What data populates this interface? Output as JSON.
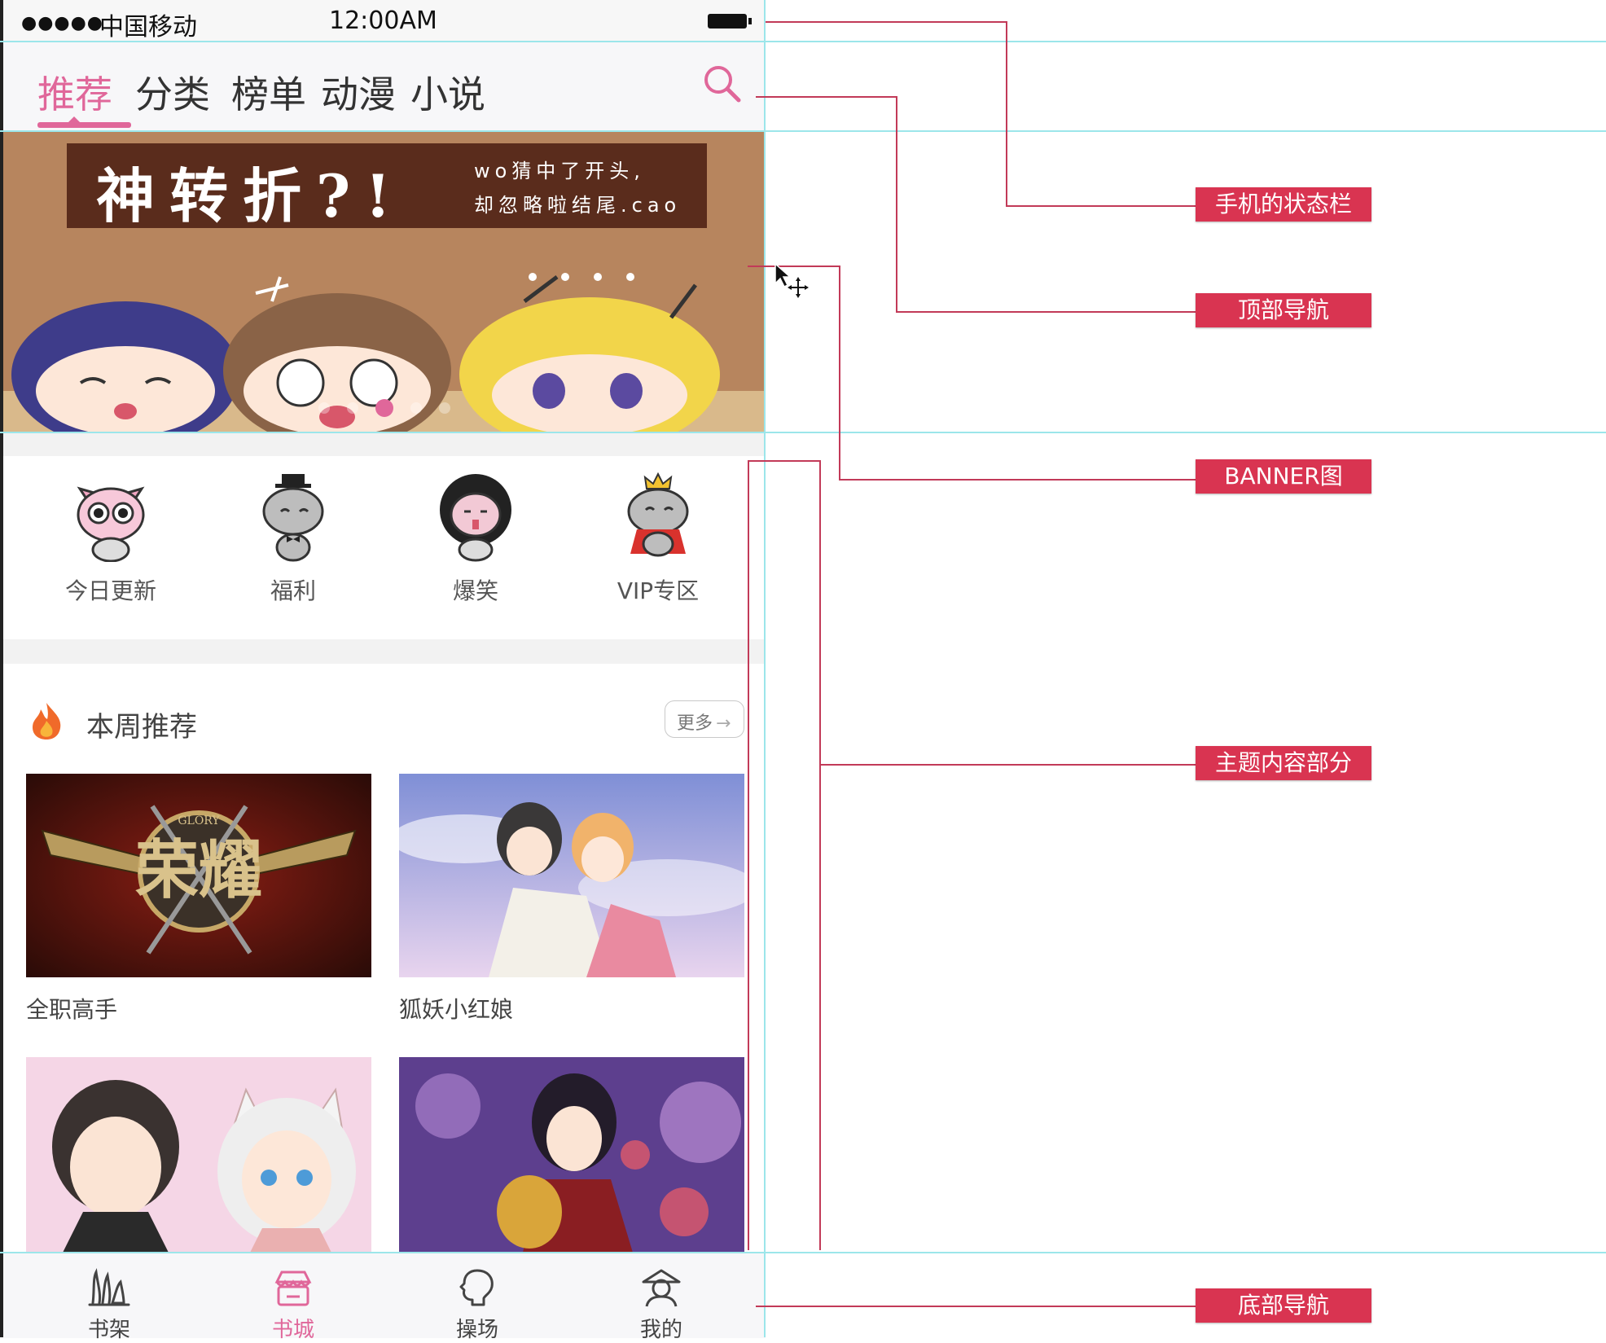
{
  "status_bar": {
    "signal": "●●●●●",
    "carrier": "中国移动",
    "time": "12:00AM"
  },
  "top_nav": {
    "tabs": [
      {
        "label": "推荐",
        "active": true
      },
      {
        "label": "分类",
        "active": false
      },
      {
        "label": "榜单",
        "active": false
      },
      {
        "label": "动漫",
        "active": false
      },
      {
        "label": "小说",
        "active": false
      }
    ],
    "search_icon": "search-icon",
    "accent_color": "#e0679a"
  },
  "banner": {
    "title": "神转折?!",
    "subtitle_line1": "wo猜中了开头,",
    "subtitle_line2": "却忽略啦结尾.cao",
    "slide_count": 5,
    "active_slide": 3
  },
  "quick_entries": [
    {
      "label": "今日更新",
      "icon": "pink-cat-icon"
    },
    {
      "label": "福利",
      "icon": "gentleman-cat-icon"
    },
    {
      "label": "爆笑",
      "icon": "afro-cat-icon"
    },
    {
      "label": "VIP专区",
      "icon": "crown-cat-icon"
    }
  ],
  "weekly": {
    "title": "本周推荐",
    "more_label": "更多",
    "more_arrow": "→",
    "items": [
      {
        "title": "全职高手",
        "cover_text": "荣耀",
        "cover_small": "GLORY"
      },
      {
        "title": "狐妖小红娘"
      },
      {
        "title": ""
      },
      {
        "title": ""
      }
    ]
  },
  "bottom_nav": {
    "items": [
      {
        "label": "书架",
        "icon": "bookshelf-icon",
        "active": false
      },
      {
        "label": "书城",
        "icon": "store-icon",
        "active": true
      },
      {
        "label": "操场",
        "icon": "playground-icon",
        "active": false
      },
      {
        "label": "我的",
        "icon": "profile-icon",
        "active": false
      }
    ]
  },
  "annotations": {
    "status_bar": "手机的状态栏",
    "top_nav": "顶部导航",
    "banner": "BANNER图",
    "main_content": "主题内容部分",
    "bottom_nav": "底部导航"
  },
  "colors": {
    "accent": "#e0679a",
    "annotation": "#d93451",
    "guide": "#9ce6ea"
  }
}
